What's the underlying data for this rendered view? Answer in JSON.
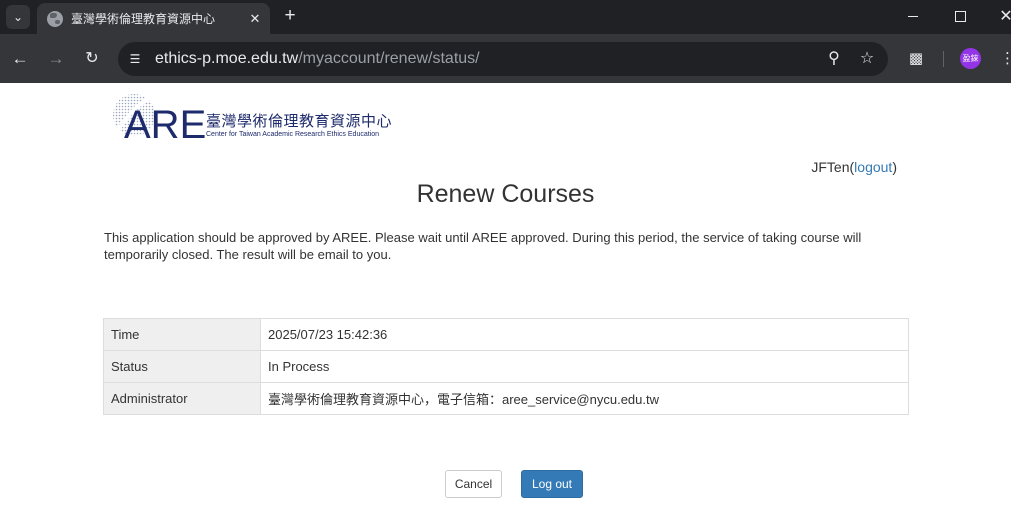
{
  "browser": {
    "tab_title": "臺灣學術倫理教育資源中心",
    "url_host": "ethics-p.moe.edu.tw",
    "url_path": "/myaccount/renew/status/",
    "profile_initials": "盈錸"
  },
  "logo": {
    "mark_text": "AREE",
    "cn_name": "臺灣學術倫理教育資源中心",
    "en_name": "Center for Taiwan Academic Research Ethics Education"
  },
  "user": {
    "username": "JFTen",
    "open_paren": "(",
    "logout_link": "logout",
    "close_paren": ")"
  },
  "page": {
    "title": "Renew Courses",
    "notice": "This application should be approved by AREE. Please wait until AREE approved. During this period, the service of taking course will temporarily closed. The result will be email to you."
  },
  "status_table": {
    "rows": [
      {
        "label": "Time",
        "value": "2025/07/23 15:42:36"
      },
      {
        "label": "Status",
        "value": "In Process"
      },
      {
        "label": "Administrator",
        "value": "臺灣學術倫理教育資源中心，電子信箱：aree_service@nycu.edu.tw"
      }
    ]
  },
  "buttons": {
    "cancel": "Cancel",
    "logout": "Log out"
  },
  "colors": {
    "primary": "#337ab7",
    "logo_navy": "#1d2a6b"
  }
}
